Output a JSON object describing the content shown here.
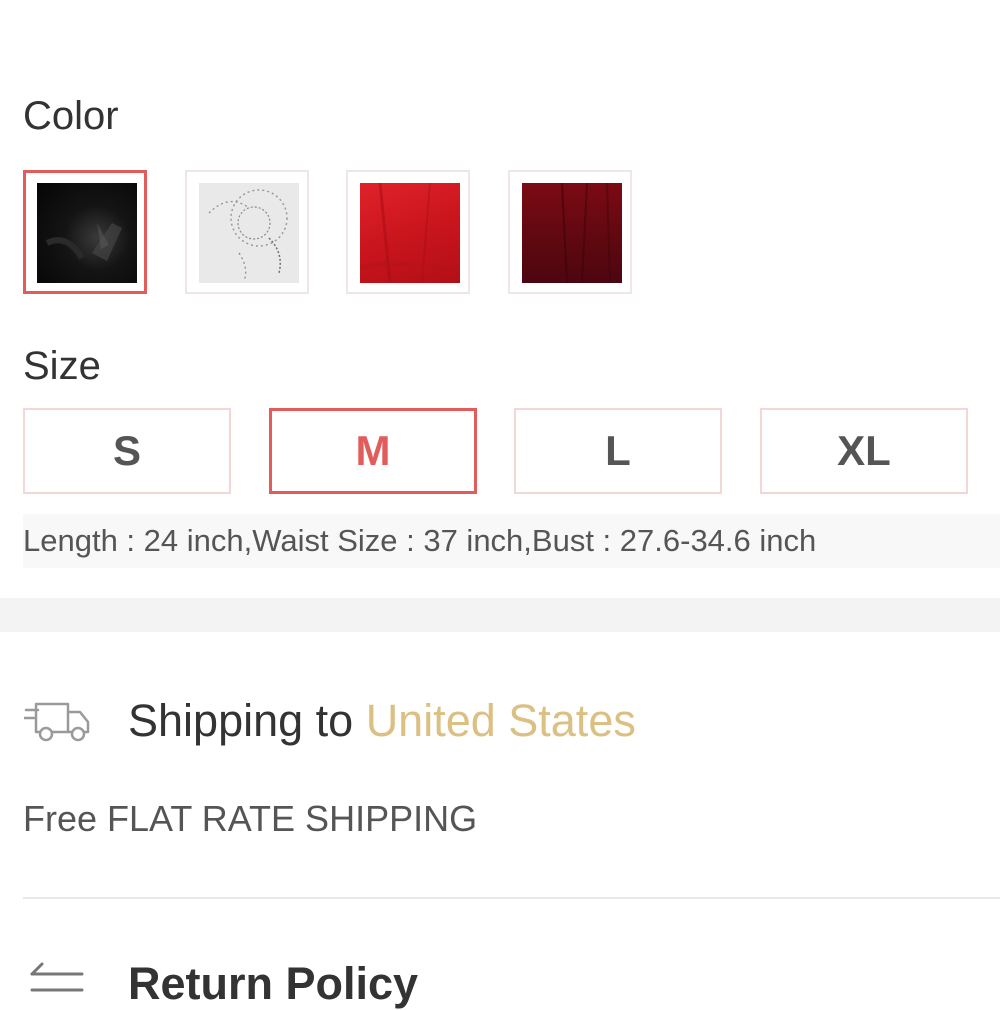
{
  "color": {
    "label": "Color",
    "swatches": [
      {
        "name": "black",
        "hex": "#0d0d0d",
        "selected": true
      },
      {
        "name": "white",
        "hex": "#e9e9e9",
        "selected": false
      },
      {
        "name": "red",
        "hex": "#c8141c",
        "selected": false
      },
      {
        "name": "wine",
        "hex": "#5e0810",
        "selected": false
      }
    ]
  },
  "size": {
    "label": "Size",
    "options": [
      {
        "label": "S",
        "selected": false
      },
      {
        "label": "M",
        "selected": true
      },
      {
        "label": "L",
        "selected": false
      },
      {
        "label": "XL",
        "selected": false
      }
    ],
    "info": "Length : 24 inch,Waist Size : 37 inch,Bust : 27.6-34.6 inch"
  },
  "shipping": {
    "icon": "truck-icon",
    "title_prefix": "Shipping to ",
    "country": "United States",
    "note": "Free FLAT RATE SHIPPING"
  },
  "return_policy": {
    "icon": "swap-arrows-icon",
    "title": "Return Policy"
  },
  "colors": {
    "accent": "#e25c5c",
    "country_text": "#dcc083",
    "text": "#333333"
  }
}
